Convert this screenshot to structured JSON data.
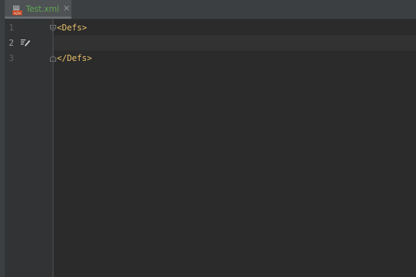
{
  "tab": {
    "label": "Test.xml",
    "close_glyph": "✕",
    "icon": "xml-file-icon",
    "label_color": "#62a252"
  },
  "gutter": {
    "line_numbers": [
      "1",
      "2",
      "3"
    ],
    "current_line": 2,
    "edit_marker_icon": "edit-pencil-icon"
  },
  "editor": {
    "lines": [
      {
        "text": "<Defs>"
      },
      {
        "text": ""
      },
      {
        "text": "</Defs>"
      }
    ],
    "tag_color": "#e8bf6a",
    "background": "#2b2b2b",
    "current_line_background": "#323232"
  }
}
